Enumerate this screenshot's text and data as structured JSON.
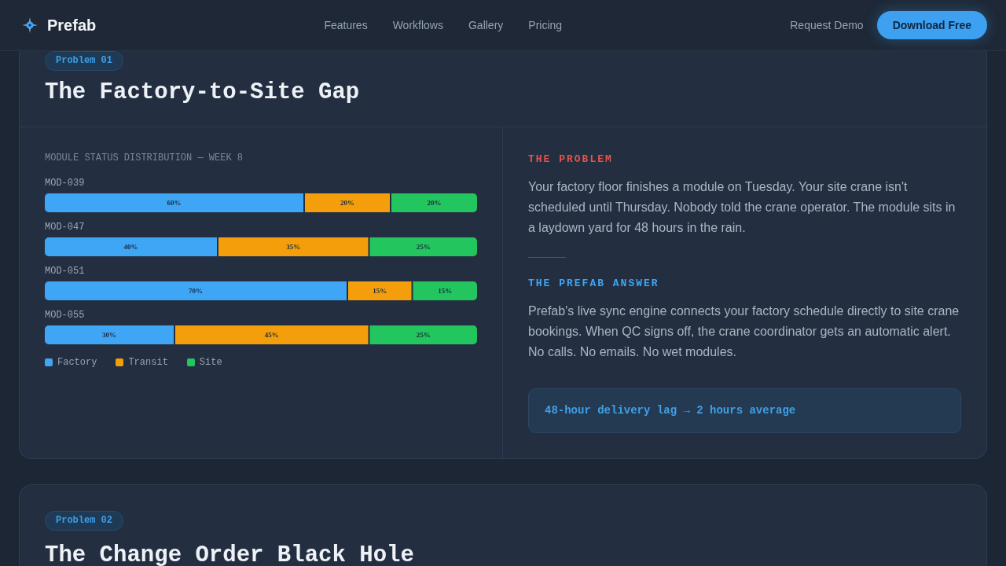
{
  "nav": {
    "brand": "Prefab",
    "links": [
      "Features",
      "Workflows",
      "Gallery",
      "Pricing"
    ],
    "secondary_link": "Request Demo",
    "cta_button": "Download Free"
  },
  "sections": [
    {
      "badge": "Problem 01",
      "title": "The Factory-to-Site Gap",
      "chart_data": [
        {
          "type": "bar",
          "orientation": "horizontal",
          "stacked": true,
          "title": "MODULE STATUS DISTRIBUTION — WEEK 8",
          "categories": [
            "MOD-039",
            "MOD-047",
            "MOD-051",
            "MOD-055"
          ],
          "series": [
            {
              "name": "Factory",
              "color": "#3ea6f5",
              "values": [
                60,
                40,
                70,
                30
              ],
              "value_labels": [
                "60%",
                "40%",
                "70%",
                "30%"
              ]
            },
            {
              "name": "Transit",
              "color": "#f59e0b",
              "values": [
                20,
                35,
                15,
                45
              ],
              "value_labels": [
                "20%",
                "35%",
                "15%",
                "45%"
              ]
            },
            {
              "name": "Site",
              "color": "#22c55e",
              "values": [
                20,
                25,
                15,
                25
              ],
              "value_labels": [
                "20%",
                "25%",
                "15%",
                "25%"
              ]
            }
          ],
          "data_labels": true,
          "legend": "bottom"
        }
      ],
      "problem": {
        "heading": "THE PROBLEM",
        "text": "Your factory floor finishes a module on Tuesday. Your site crane isn't scheduled until Thursday. Nobody told the crane operator. The module sits in a laydown yard for 48 hours in the rain."
      },
      "answer": {
        "heading": "THE PREFAB ANSWER",
        "text": "Prefab's live sync engine connects your factory schedule directly to site crane bookings. When QC signs off, the crane coordinator gets an automatic alert. No calls. No emails. No wet modules."
      },
      "result": "48-hour delivery lag → 2 hours average"
    },
    {
      "badge": "Problem 02",
      "title": "The Change Order Black Hole"
    }
  ]
}
